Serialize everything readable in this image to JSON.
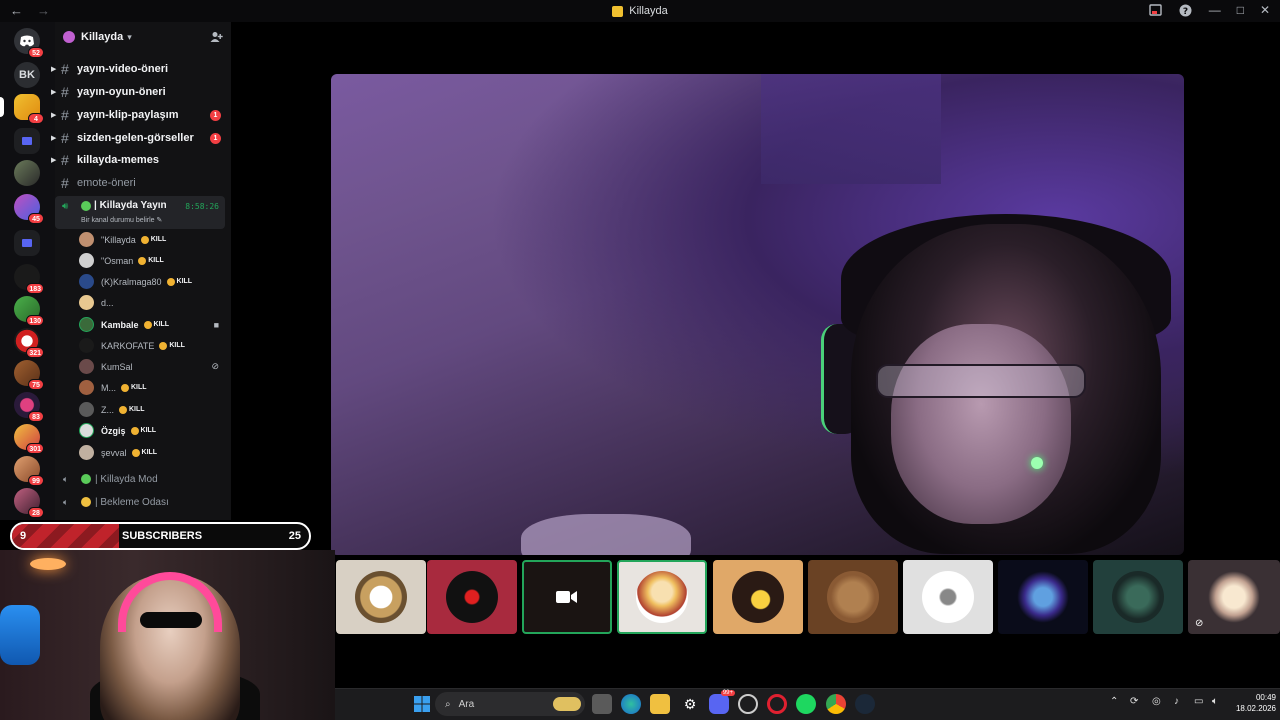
{
  "window": {
    "title": "Killayda",
    "nav_back": "←",
    "nav_forward": "→",
    "minimize": "—",
    "maximize": "□",
    "close": "✕",
    "help": "?"
  },
  "rail": {
    "badges": [
      "52",
      "4",
      "45",
      "183",
      "130",
      "321",
      "75",
      "83",
      "301",
      "99",
      "28"
    ],
    "bk_label": "BK"
  },
  "server": {
    "name": "Killayda",
    "channels": [
      {
        "name": "yayın-video-öneri",
        "mention": ""
      },
      {
        "name": "yayın-oyun-öneri",
        "mention": ""
      },
      {
        "name": "yayın-klip-paylaşım",
        "mention": "1"
      },
      {
        "name": "sizden-gelen-görseller",
        "mention": "1"
      },
      {
        "name": "killayda-memes",
        "mention": ""
      },
      {
        "name": "emote-öneri",
        "mention": ""
      }
    ],
    "voice_channel": {
      "name": "| Killayda Yayın",
      "timer": "8:58:26",
      "status": "Bir kanal durumu belirle"
    },
    "members": [
      {
        "name": "\"Killayda",
        "tag": "KILL",
        "bold": false
      },
      {
        "name": "\"Osman",
        "tag": "KILL",
        "bold": false
      },
      {
        "name": "(K)Kralmaga80",
        "tag": "KILL",
        "bold": false
      },
      {
        "name": "d...",
        "tag": "",
        "bold": false
      },
      {
        "name": "Kambale",
        "tag": "KILL",
        "bold": true
      },
      {
        "name": "KARKOFATE",
        "tag": "KILL",
        "bold": false
      },
      {
        "name": "KumSal",
        "tag": "",
        "bold": false
      },
      {
        "name": "M...",
        "tag": "KILL",
        "bold": false
      },
      {
        "name": "Z...",
        "tag": "KILL",
        "bold": false
      },
      {
        "name": "Özgiş",
        "tag": "KILL",
        "bold": true
      },
      {
        "name": "şevval",
        "tag": "KILL",
        "bold": false
      }
    ],
    "other_voice": [
      {
        "name": "| Killayda Mod"
      },
      {
        "name": "| Bekleme Odası"
      }
    ]
  },
  "overlay": {
    "sub_count": "9",
    "sub_label": "SUBSCRIBERS",
    "sub_goal": "25",
    "sub_progress": 0.36
  },
  "taskbar": {
    "search_placeholder": "Ara",
    "time": "00:49",
    "date": "18.02.2026",
    "discord_badge": "99+"
  },
  "colors": {
    "accent_green": "#23a55a",
    "mention_red": "#f23f43",
    "sub_red": "#c0232b"
  }
}
